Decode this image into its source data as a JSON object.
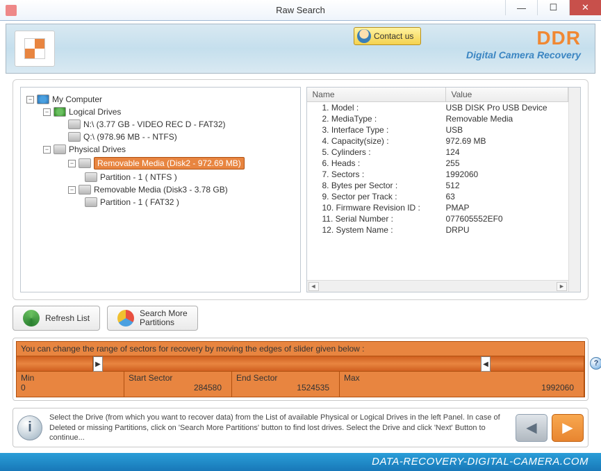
{
  "window": {
    "title": "Raw Search"
  },
  "header": {
    "contact_label": "Contact us",
    "brand": "DDR",
    "brand_sub": "Digital Camera Recovery"
  },
  "tree": {
    "root": "My Computer",
    "logical": "Logical Drives",
    "drive_n": "N:\\ (3.77 GB - VIDEO REC D - FAT32)",
    "drive_q": "Q:\\ (978.96 MB -  - NTFS)",
    "physical": "Physical Drives",
    "disk2": "Removable Media (Disk2 - 972.69 MB)",
    "disk2_part": "Partition - 1 ( NTFS )",
    "disk3": "Removable Media (Disk3 - 3.78 GB)",
    "disk3_part": "Partition - 1 ( FAT32 )"
  },
  "props": {
    "header_name": "Name",
    "header_value": "Value",
    "rows": [
      {
        "n": "1. Model :",
        "v": "USB DISK Pro USB Device"
      },
      {
        "n": "2. MediaType :",
        "v": "Removable Media"
      },
      {
        "n": "3. Interface Type :",
        "v": "USB"
      },
      {
        "n": "4. Capacity(size) :",
        "v": "972.69 MB"
      },
      {
        "n": "5. Cylinders :",
        "v": "124"
      },
      {
        "n": "6. Heads :",
        "v": "255"
      },
      {
        "n": "7. Sectors :",
        "v": "1992060"
      },
      {
        "n": "8. Bytes per Sector :",
        "v": "512"
      },
      {
        "n": "9. Sector per Track :",
        "v": "63"
      },
      {
        "n": "10. Firmware Revision ID :",
        "v": "PMAP"
      },
      {
        "n": "11. Serial Number :",
        "v": "077605552EF0"
      },
      {
        "n": "12. System Name :",
        "v": "DRPU"
      }
    ]
  },
  "buttons": {
    "refresh": "Refresh List",
    "search_more": "Search More\nPartitions"
  },
  "slider": {
    "msg": "You can change the range of sectors for recovery by moving the edges of slider given below :",
    "min_label": "Min",
    "min_val": "0",
    "start_label": "Start Sector",
    "start_val": "284580",
    "end_label": "End Sector",
    "end_val": "1524535",
    "max_label": "Max",
    "max_val": "1992060"
  },
  "info": "Select the Drive (from which you want to recover data) from the List of available Physical or Logical Drives in the left Panel. In case of Deleted or missing Partitions, click on 'Search More Partitions' button to find lost drives. Select the Drive and click 'Next' Button to continue...",
  "watermark": "DATA-RECOVERY-DIGITAL-CAMERA.COM"
}
